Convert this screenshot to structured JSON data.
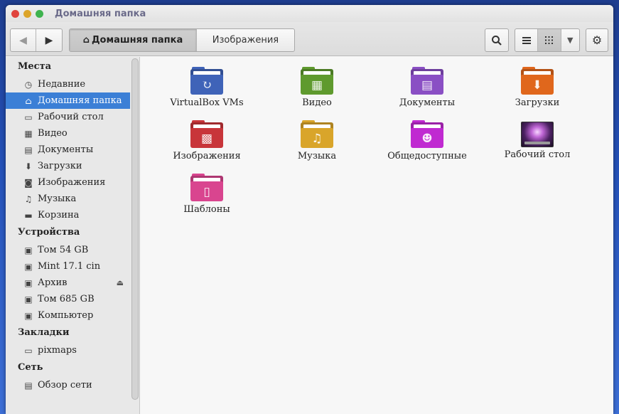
{
  "window": {
    "title": "Домашняя папка"
  },
  "toolbar": {
    "back_glyph": "◀",
    "forward_glyph": "▶",
    "crumbs": [
      "Домашняя папка",
      "Изображения"
    ],
    "search_glyph": "⌕",
    "list_view_glyph": "☰",
    "grid_view_glyph": "⁞⁞⁞",
    "dropdown_glyph": "▼",
    "settings_glyph": "⚙"
  },
  "sidebar": {
    "sections": [
      {
        "title": "Места",
        "items": [
          {
            "label": "Недавние",
            "icon": "clock-icon",
            "glyph": "◷"
          },
          {
            "label": "Домашняя папка",
            "icon": "home-icon",
            "glyph": "⌂",
            "selected": true
          },
          {
            "label": "Рабочий стол",
            "icon": "desktop-icon",
            "glyph": "▭"
          },
          {
            "label": "Видео",
            "icon": "film-icon",
            "glyph": "▦"
          },
          {
            "label": "Документы",
            "icon": "document-icon",
            "glyph": "▤"
          },
          {
            "label": "Загрузки",
            "icon": "download-icon",
            "glyph": "⬇"
          },
          {
            "label": "Изображения",
            "icon": "camera-icon",
            "glyph": "◙"
          },
          {
            "label": "Музыка",
            "icon": "music-icon",
            "glyph": "♫"
          },
          {
            "label": "Корзина",
            "icon": "trash-icon",
            "glyph": "▬"
          }
        ]
      },
      {
        "title": "Устройства",
        "items": [
          {
            "label": "Том 54 GB",
            "icon": "drive-icon",
            "glyph": "▣"
          },
          {
            "label": "Mint 17.1 cin",
            "icon": "drive-icon",
            "glyph": "▣"
          },
          {
            "label": "Архив",
            "icon": "drive-icon",
            "glyph": "▣",
            "eject": "⏏"
          },
          {
            "label": "Том 685 GB",
            "icon": "drive-icon",
            "glyph": "▣"
          },
          {
            "label": "Компьютер",
            "icon": "drive-icon",
            "glyph": "▣"
          }
        ]
      },
      {
        "title": "Закладки",
        "items": [
          {
            "label": "pixmaps",
            "icon": "folder-icon",
            "glyph": "▭"
          }
        ]
      },
      {
        "title": "Сеть",
        "items": [
          {
            "label": "Обзор сети",
            "icon": "network-icon",
            "glyph": "▤"
          }
        ]
      }
    ]
  },
  "files": [
    {
      "label": "VirtualBox VMs",
      "icon": "virtualbox-folder-icon",
      "color": "#3f63b8",
      "emblem": "↻"
    },
    {
      "label": "Видео",
      "icon": "video-folder-icon",
      "color": "#5f9a2e",
      "emblem": "▦"
    },
    {
      "label": "Документы",
      "icon": "documents-folder-icon",
      "color": "#8a4fc4",
      "emblem": "▤"
    },
    {
      "label": "Загрузки",
      "icon": "downloads-folder-icon",
      "color": "#e0671c",
      "emblem": "⬇"
    },
    {
      "label": "Изображения",
      "icon": "pictures-folder-icon",
      "color": "#c8353a",
      "emblem": "▩"
    },
    {
      "label": "Музыка",
      "icon": "music-folder-icon",
      "color": "#d9a52a",
      "emblem": "♫"
    },
    {
      "label": "Общедоступные",
      "icon": "public-folder-icon",
      "color": "#c02ad1",
      "emblem": "☻"
    },
    {
      "label": "Рабочий стол",
      "icon": "desktop-folder-icon",
      "color": "#6b2a8a",
      "emblem": ""
    },
    {
      "label": "Шаблоны",
      "icon": "templates-folder-icon",
      "color": "#d9458f",
      "emblem": "▯"
    }
  ]
}
